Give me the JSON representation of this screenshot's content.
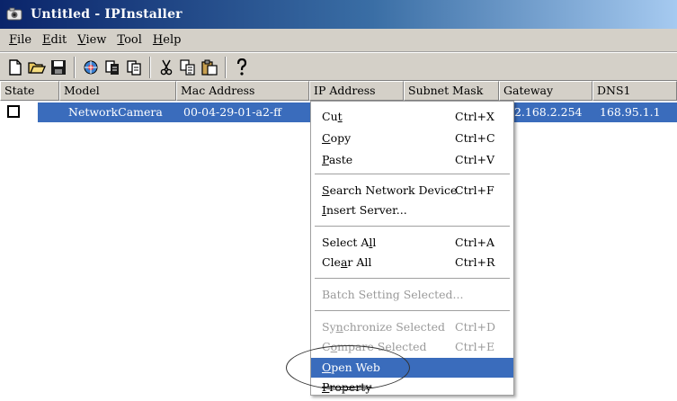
{
  "window": {
    "title": "Untitled - IPInstaller"
  },
  "menubar": {
    "items": [
      {
        "first": "F",
        "rest": "ile"
      },
      {
        "first": "E",
        "rest": "dit"
      },
      {
        "first": "V",
        "rest": "iew"
      },
      {
        "first": "T",
        "rest": "ool"
      },
      {
        "first": "H",
        "rest": "elp"
      }
    ]
  },
  "toolbar": {
    "icons": [
      "new-file-icon",
      "open-folder-icon",
      "save-icon",
      "search-device-icon",
      "insert-server-icon",
      "property-icon",
      "cut-icon",
      "copy-icon",
      "paste-icon",
      "help-icon"
    ]
  },
  "table": {
    "headers": [
      "State",
      "Model",
      "Mac Address",
      "IP Address",
      "Subnet Mask",
      "Gateway",
      "DNS1"
    ],
    "rows": [
      {
        "model": "NetworkCamera",
        "mac": "00-04-29-01-a2-ff",
        "gateway": "92.168.2.254",
        "dns1": "168.95.1.1"
      }
    ]
  },
  "context_menu": {
    "cut": {
      "pre": "Cu",
      "u": "t",
      "post": "",
      "shortcut": "Ctrl+X"
    },
    "copy": {
      "pre": "",
      "u": "C",
      "post": "opy",
      "shortcut": "Ctrl+C"
    },
    "paste": {
      "pre": "",
      "u": "P",
      "post": "aste",
      "shortcut": "Ctrl+V"
    },
    "search": {
      "pre": "",
      "u": "S",
      "post": "earch Network Device",
      "shortcut": "Ctrl+F"
    },
    "insert": {
      "pre": "",
      "u": "I",
      "post": "nsert Server...",
      "shortcut": ""
    },
    "select_all": {
      "pre": "Select A",
      "u": "l",
      "post": "l",
      "shortcut": "Ctrl+A"
    },
    "clear_all": {
      "pre": "Cle",
      "u": "a",
      "post": "r All",
      "shortcut": "Ctrl+R"
    },
    "batch": {
      "pre": "",
      "u": "",
      "post": "Batch Setting Selected...",
      "shortcut": ""
    },
    "sync": {
      "pre": "Sy",
      "u": "n",
      "post": "chronize Selected",
      "shortcut": "Ctrl+D"
    },
    "compare": {
      "pre": "C",
      "u": "o",
      "post": "mpare Selected",
      "shortcut": "Ctrl+E"
    },
    "open_web": {
      "pre": "",
      "u": "O",
      "post": "pen Web",
      "shortcut": ""
    },
    "property": {
      "pre": "",
      "u": "P",
      "post": "roperty",
      "shortcut": ""
    }
  },
  "colors": {
    "selection": "#3a6cbc",
    "title_bar_start": "#0a246a",
    "title_bar_end": "#a6caf0",
    "chrome": "#d4d0c8"
  }
}
